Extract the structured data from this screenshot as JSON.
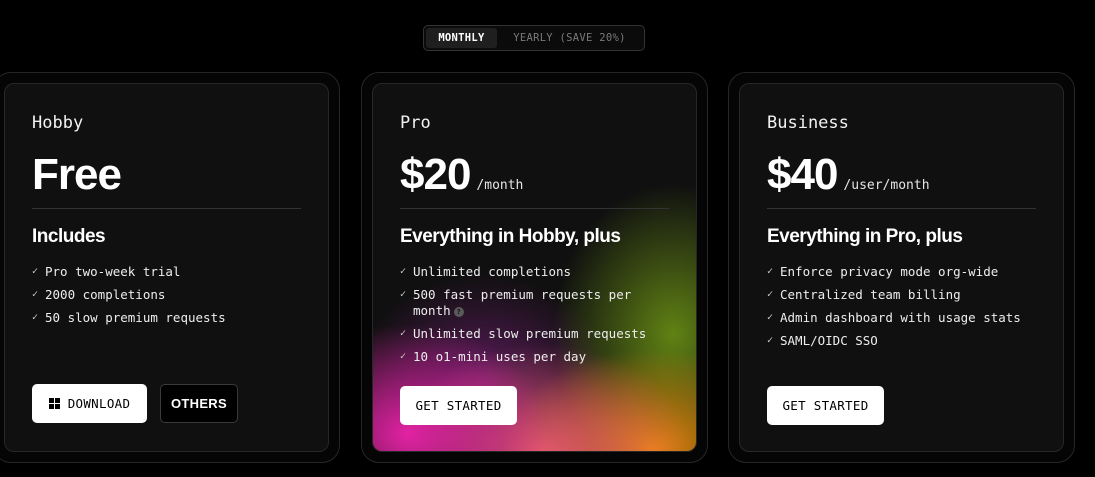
{
  "billing_toggle": {
    "monthly_label": "MONTHLY",
    "yearly_label": "YEARLY (SAVE 20%)",
    "selected": "monthly"
  },
  "plans": [
    {
      "tier": "Hobby",
      "price": "Free",
      "period": "",
      "heading": "Includes",
      "features": [
        "Pro two-week trial",
        "2000 completions",
        "50 slow premium requests"
      ],
      "primary_button": "DOWNLOAD",
      "secondary_button": "OTHERS"
    },
    {
      "tier": "Pro",
      "price": "$20",
      "period": "/month",
      "heading": "Everything in Hobby, plus",
      "features": [
        "Unlimited completions",
        "500 fast premium requests per month",
        "Unlimited slow premium requests",
        "10 o1-mini uses per day"
      ],
      "help_glyph": "?",
      "primary_button": "GET STARTED"
    },
    {
      "tier": "Business",
      "price": "$40",
      "period": "/user/month",
      "heading": "Everything in Pro, plus",
      "features": [
        "Enforce privacy mode org-wide",
        "Centralized team billing",
        "Admin dashboard with usage stats",
        "SAML/OIDC SSO"
      ],
      "primary_button": "GET STARTED"
    }
  ],
  "check_glyph": "✓",
  "icons": {
    "download": "windows-icon",
    "feature_check": "check-icon",
    "info": "help-icon"
  },
  "colors": {
    "background": "#000000",
    "card": "#101010",
    "button_light": "#ffffff",
    "glow_pink": "#ec23aa",
    "glow_orange": "#f08c0a",
    "glow_green": "#6e9614"
  }
}
